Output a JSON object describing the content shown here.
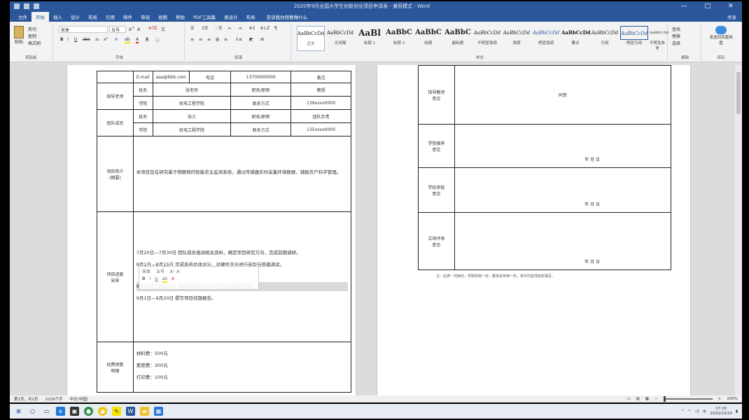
{
  "window": {
    "title": "2020年9月全国大学生创新创业项目申请表 - 兼容模式 - Word",
    "user": "",
    "controls": [
      "—",
      "□",
      "✕"
    ]
  },
  "tabs": [
    {
      "label": "文件"
    },
    {
      "label": "开始"
    },
    {
      "label": "插入"
    },
    {
      "label": "设计"
    },
    {
      "label": "布局"
    },
    {
      "label": "引用"
    },
    {
      "label": "邮件"
    },
    {
      "label": "审阅"
    },
    {
      "label": "视图"
    },
    {
      "label": "帮助"
    },
    {
      "label": "PDF工具集"
    },
    {
      "label": "表设计"
    },
    {
      "label": "布局"
    }
  ],
  "tell_me": "告诉我你想要做什么",
  "share": "共享",
  "ribbon": {
    "clipboard": {
      "paste": "粘贴",
      "cut": "剪切",
      "copy": "复制",
      "format_painter": "格式刷",
      "label": "剪贴板"
    },
    "font": {
      "name": "宋体",
      "size": "五号",
      "label": "字体"
    },
    "paragraph": {
      "label": "段落"
    },
    "styles": {
      "label": "样式",
      "items": [
        {
          "preview": "AaBbCcDd",
          "name": "正文"
        },
        {
          "preview": "AaBbCcDd",
          "name": "无间隔"
        },
        {
          "preview": "AaBl",
          "name": "标题 1"
        },
        {
          "preview": "AaBbC",
          "name": "标题 2"
        },
        {
          "preview": "AaBbC",
          "name": "标题"
        },
        {
          "preview": "AaBbC",
          "name": "副标题"
        },
        {
          "preview": "AaBbCcDd",
          "name": "不明显强调"
        },
        {
          "preview": "AaBbCcDd",
          "name": "强调"
        },
        {
          "preview": "AaBbCcDd",
          "name": "明显强调"
        },
        {
          "preview": "AaBbCcDd",
          "name": "要点"
        },
        {
          "preview": "AaBbCcDd",
          "name": "引用"
        },
        {
          "preview": "AaBbCcDd",
          "name": "明显引用"
        },
        {
          "preview": "AaBbCcDd",
          "name": "不明显参考"
        }
      ]
    },
    "editing": {
      "find": "查找",
      "replace": "替换",
      "select": "选择",
      "label": "编辑"
    },
    "addin": {
      "name": "发送到百度网盘",
      "label": "保存"
    }
  },
  "page1": {
    "rows": [
      {
        "c": [
          "",
          "E-mail",
          "aaa@bbb.com",
          "电话",
          "13700000000",
          "备注"
        ]
      },
      {
        "label": "指导老师",
        "c": [
          "姓名",
          "张老师",
          "职务/职称",
          "教授"
        ]
      },
      {
        "c": [
          "学院",
          "机电工程学院",
          "联系方式",
          "139xxxx0000"
        ]
      },
      {
        "label": "团队成员",
        "c": [
          "姓名",
          "张三",
          "职务/职称",
          "团队负责"
        ]
      },
      {
        "c": [
          "学院",
          "机电工程学院",
          "联系方式",
          "135xxxx0000"
        ]
      }
    ],
    "project_intro_label": "项目简介\n(摘要)",
    "project_intro": "本项目旨在研究基于物联网的智能农业监测系统，通过传感器实时采集环境数据，辅助农户科学管理。",
    "plan_label": "项目进度\n安排",
    "plan_lines": [
      "7月20日—7月30日  团队成员查阅相关资料，确定项目研究方向，完成前期调研。",
      "8月1日—8月15日  完成系统总体设计，对硬件平台进行选型与搭建调试。",
      "8月16日—8月30日  完成系统软件部分的开发与测试工作。",
      "9月1日—9月20日  撰写项目结题报告。"
    ],
    "budget_label": "经费预算\n明细",
    "budget_lines": [
      "材料费：500元",
      "差旅费：300元",
      "打印费：100元"
    ]
  },
  "page2": {
    "rows": [
      {
        "label": "指导教师\n意见",
        "content": "同意",
        "sign": ""
      },
      {
        "label": "学院推荐\n意见",
        "content": "",
        "sign": "年  月  日"
      },
      {
        "label": "学校审批\n意见",
        "content": "",
        "sign": "年  月  日"
      },
      {
        "label": "立项评审\n意见",
        "content": "",
        "sign": "年  月  日"
      }
    ],
    "footnote": "注：此表一式两份，学院存档一份，教务处存档一份，表中内容须如实填写。"
  },
  "mini_toolbar": {
    "font": "宋体",
    "size": "五号"
  },
  "status": {
    "page": "第1页，共2页",
    "words": "1029个字",
    "lang": "中文(中国)",
    "zoom": "100%"
  },
  "taskbar": {
    "time": "17:29",
    "date": "2020/10/14"
  }
}
